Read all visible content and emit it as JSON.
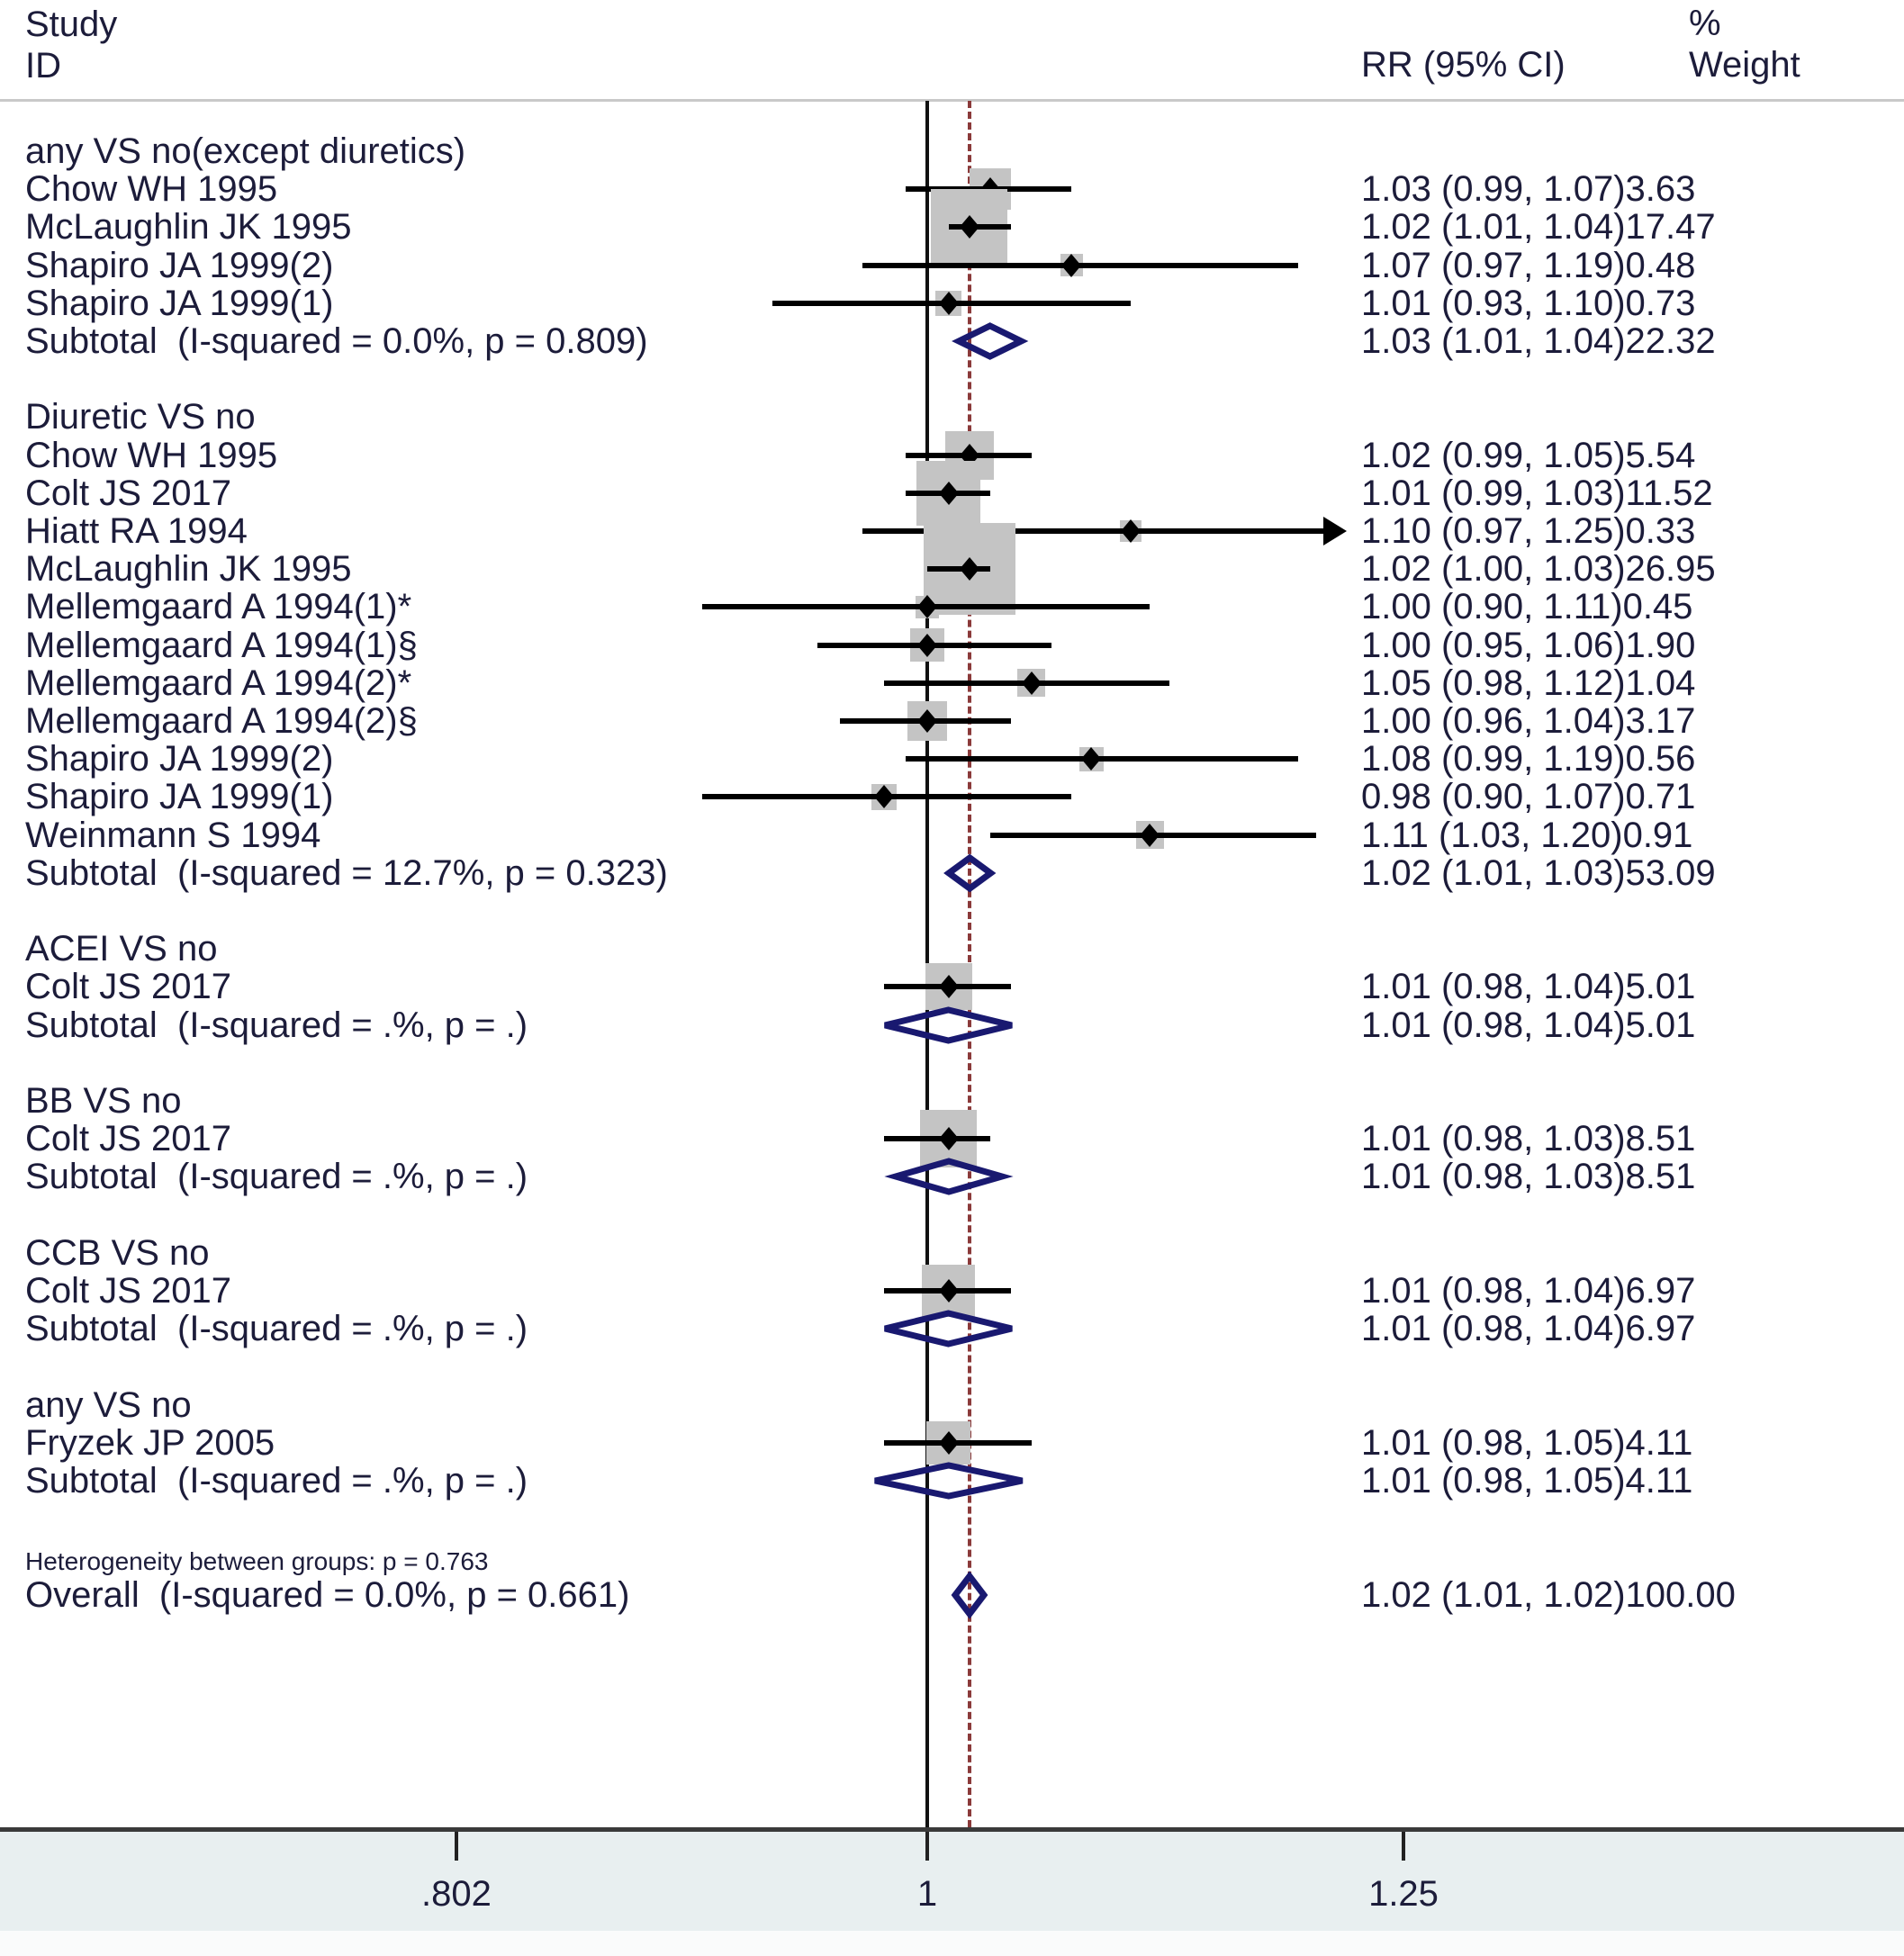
{
  "header": {
    "study_id": "Study\nID",
    "rr_label": "RR (95% CI)",
    "percent_symbol": "%",
    "weight_label": "Weight"
  },
  "footer": {
    "heterogeneity": "Heterogeneity between groups: p = 0.763"
  },
  "colors": {
    "box": "#c4c4c4",
    "marker": "#000000",
    "diamond": "#191970",
    "null_line": "#111111",
    "dashed_line": "#8b3a3a",
    "axis_band": "#e8eff0",
    "text": "#1c1c3a"
  },
  "chart_data": {
    "type": "forest",
    "title": "",
    "xlabel": "",
    "effect_measure": "RR (95% CI)",
    "xscale": "log",
    "xticks": [
      0.802,
      1,
      1.25
    ],
    "xtick_labels": [
      ".802",
      "1",
      "1.25"
    ],
    "xlim": [
      0.802,
      1.25
    ],
    "null_value": 1.0,
    "overall_value": 1.02,
    "groups": [
      {
        "name": "any VS no(except diuretics)",
        "studies": [
          {
            "label": "Chow WH 1995",
            "rr": 1.03,
            "lo": 0.99,
            "hi": 1.07,
            "weight": 3.63,
            "stat": "1.03 (0.99, 1.07)3.63"
          },
          {
            "label": "McLaughlin JK 1995",
            "rr": 1.02,
            "lo": 1.01,
            "hi": 1.04,
            "weight": 17.47,
            "stat": "1.02 (1.01, 1.04)17.47"
          },
          {
            "label": "Shapiro JA 1999(2)",
            "rr": 1.07,
            "lo": 0.97,
            "hi": 1.19,
            "weight": 0.48,
            "stat": "1.07 (0.97, 1.19)0.48"
          },
          {
            "label": "Shapiro JA 1999(1)",
            "rr": 1.01,
            "lo": 0.93,
            "hi": 1.1,
            "weight": 0.73,
            "stat": "1.01 (0.93, 1.10)0.73"
          }
        ],
        "subtotal": {
          "label": "Subtotal  (I-squared = 0.0%, p = 0.809)",
          "rr": 1.03,
          "lo": 1.01,
          "hi": 1.04,
          "weight": 22.32,
          "stat": "1.03 (1.01, 1.04)22.32"
        }
      },
      {
        "name": "Diuretic VS no",
        "studies": [
          {
            "label": "Chow WH 1995",
            "rr": 1.02,
            "lo": 0.99,
            "hi": 1.05,
            "weight": 5.54,
            "stat": "1.02 (0.99, 1.05)5.54"
          },
          {
            "label": "Colt JS 2017",
            "rr": 1.01,
            "lo": 0.99,
            "hi": 1.03,
            "weight": 11.52,
            "stat": "1.01 (0.99, 1.03)11.52"
          },
          {
            "label": "Hiatt RA 1994",
            "rr": 1.1,
            "lo": 0.97,
            "hi": 1.25,
            "weight": 0.33,
            "stat": "1.10 (0.97, 1.25)0.33",
            "clipped_right": true
          },
          {
            "label": "McLaughlin JK 1995",
            "rr": 1.02,
            "lo": 1.0,
            "hi": 1.03,
            "weight": 26.95,
            "stat": "1.02 (1.00, 1.03)26.95"
          },
          {
            "label": "Mellemgaard A 1994(1)*",
            "rr": 1.0,
            "lo": 0.9,
            "hi": 1.11,
            "weight": 0.45,
            "stat": "1.00 (0.90, 1.11)0.45"
          },
          {
            "label": "Mellemgaard A 1994(1)§",
            "rr": 1.0,
            "lo": 0.95,
            "hi": 1.06,
            "weight": 1.9,
            "stat": "1.00 (0.95, 1.06)1.90"
          },
          {
            "label": "Mellemgaard A 1994(2)*",
            "rr": 1.05,
            "lo": 0.98,
            "hi": 1.12,
            "weight": 1.04,
            "stat": "1.05 (0.98, 1.12)1.04"
          },
          {
            "label": "Mellemgaard A 1994(2)§",
            "rr": 1.0,
            "lo": 0.96,
            "hi": 1.04,
            "weight": 3.17,
            "stat": "1.00 (0.96, 1.04)3.17"
          },
          {
            "label": "Shapiro JA 1999(2)",
            "rr": 1.08,
            "lo": 0.99,
            "hi": 1.19,
            "weight": 0.56,
            "stat": "1.08 (0.99, 1.19)0.56"
          },
          {
            "label": "Shapiro JA 1999(1)",
            "rr": 0.98,
            "lo": 0.9,
            "hi": 1.07,
            "weight": 0.71,
            "stat": "0.98 (0.90, 1.07)0.71"
          },
          {
            "label": "Weinmann S 1994",
            "rr": 1.11,
            "lo": 1.03,
            "hi": 1.2,
            "weight": 0.91,
            "stat": "1.11 (1.03, 1.20)0.91"
          }
        ],
        "subtotal": {
          "label": "Subtotal  (I-squared = 12.7%, p = 0.323)",
          "rr": 1.02,
          "lo": 1.01,
          "hi": 1.03,
          "weight": 53.09,
          "stat": "1.02 (1.01, 1.03)53.09"
        }
      },
      {
        "name": "ACEI VS no",
        "studies": [
          {
            "label": "Colt JS 2017",
            "rr": 1.01,
            "lo": 0.98,
            "hi": 1.04,
            "weight": 5.01,
            "stat": "1.01 (0.98, 1.04)5.01"
          }
        ],
        "subtotal": {
          "label": "Subtotal  (I-squared = .%, p = .)",
          "rr": 1.01,
          "lo": 0.98,
          "hi": 1.04,
          "weight": 5.01,
          "stat": "1.01 (0.98, 1.04)5.01"
        }
      },
      {
        "name": "BB VS no",
        "studies": [
          {
            "label": "Colt JS 2017",
            "rr": 1.01,
            "lo": 0.98,
            "hi": 1.03,
            "weight": 8.51,
            "stat": "1.01 (0.98, 1.03)8.51"
          }
        ],
        "subtotal": {
          "label": "Subtotal  (I-squared = .%, p = .)",
          "rr": 1.01,
          "lo": 0.98,
          "hi": 1.03,
          "weight": 8.51,
          "stat": "1.01 (0.98, 1.03)8.51"
        }
      },
      {
        "name": "CCB VS no",
        "studies": [
          {
            "label": "Colt JS 2017",
            "rr": 1.01,
            "lo": 0.98,
            "hi": 1.04,
            "weight": 6.97,
            "stat": "1.01 (0.98, 1.04)6.97"
          }
        ],
        "subtotal": {
          "label": "Subtotal  (I-squared = .%, p = .)",
          "rr": 1.01,
          "lo": 0.98,
          "hi": 1.04,
          "weight": 6.97,
          "stat": "1.01 (0.98, 1.04)6.97"
        }
      },
      {
        "name": "any VS no",
        "studies": [
          {
            "label": "Fryzek JP 2005",
            "rr": 1.01,
            "lo": 0.98,
            "hi": 1.05,
            "weight": 4.11,
            "stat": "1.01 (0.98, 1.05)4.11"
          }
        ],
        "subtotal": {
          "label": "Subtotal  (I-squared = .%, p = .)",
          "rr": 1.01,
          "lo": 0.98,
          "hi": 1.05,
          "weight": 4.11,
          "stat": "1.01 (0.98, 1.05)4.11"
        }
      }
    ],
    "overall": {
      "label": "Overall  (I-squared = 0.0%, p = 0.661)",
      "rr": 1.02,
      "lo": 1.01,
      "hi": 1.02,
      "weight": 100.0,
      "stat": "1.02 (1.01, 1.02)100.00"
    }
  }
}
